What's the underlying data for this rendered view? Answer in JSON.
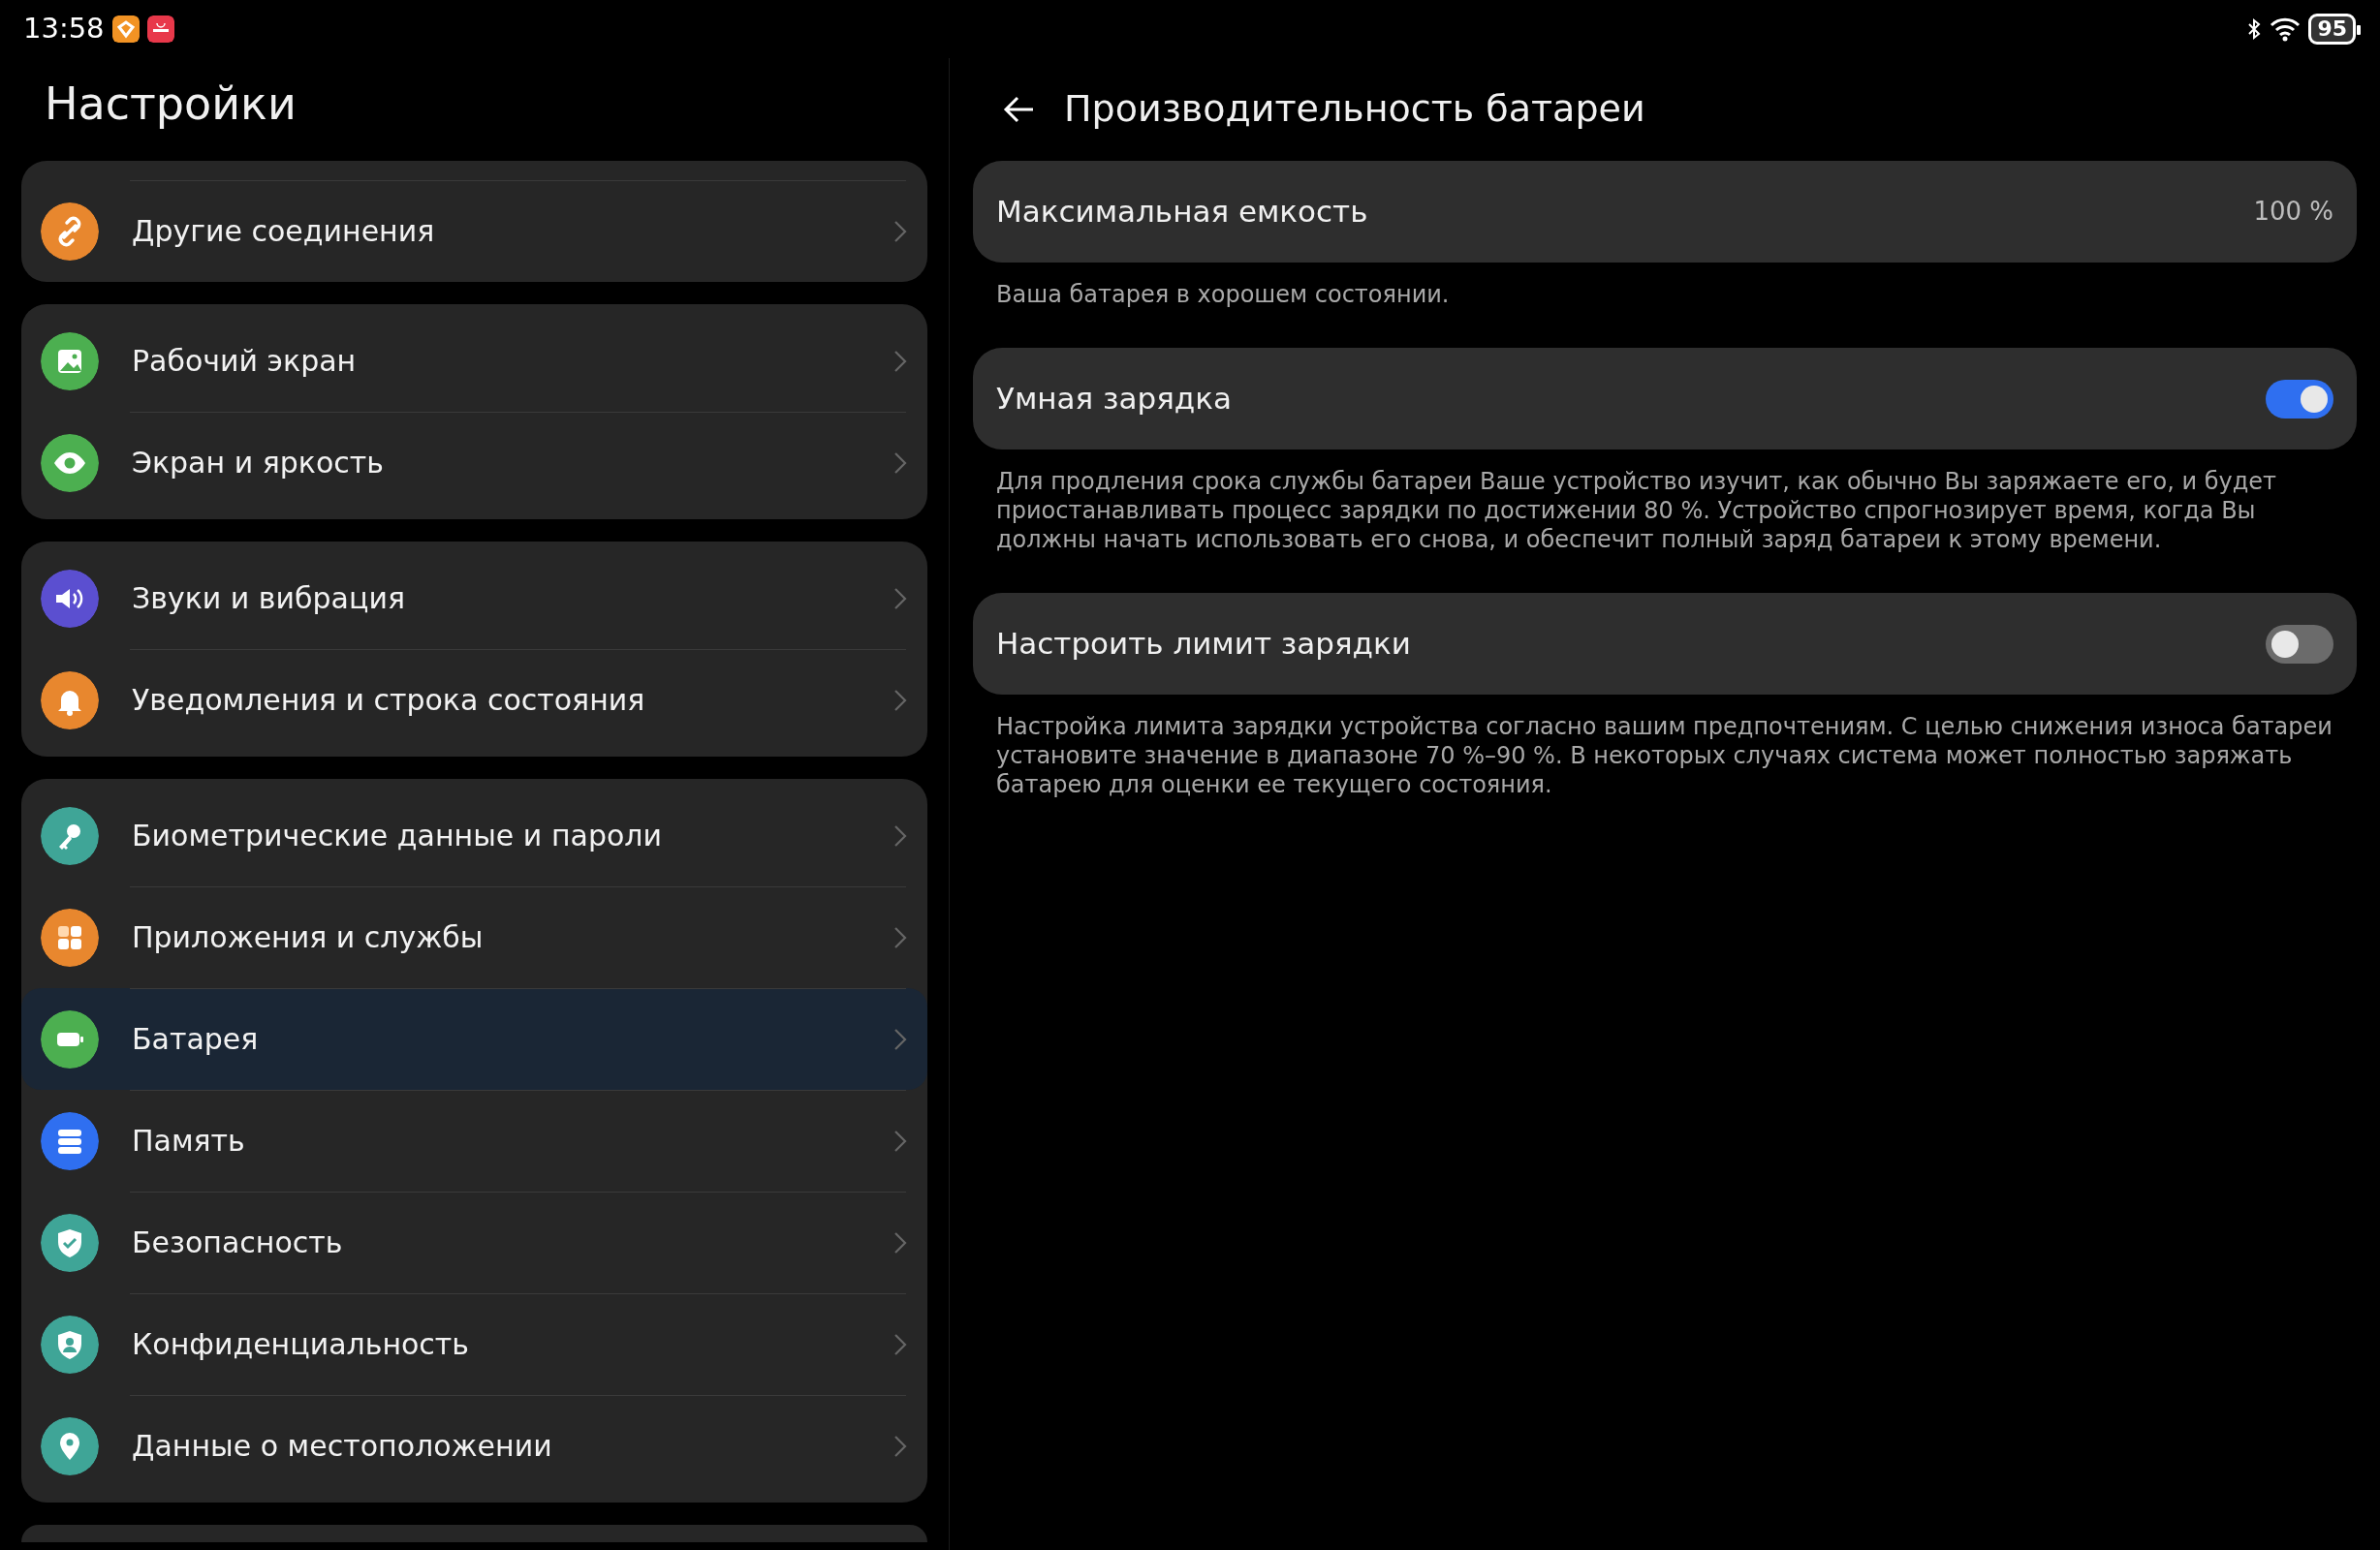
{
  "status_bar": {
    "time": "13:58",
    "battery": "95"
  },
  "sidebar": {
    "title": "Настройки",
    "groups": [
      {
        "partial_top": true,
        "items": [
          {
            "label": "Другие соединения",
            "kind": "link",
            "color": "#e8872e",
            "selected": false
          }
        ]
      },
      {
        "partial_top": false,
        "items": [
          {
            "label": "Рабочий экран",
            "kind": "image",
            "color": "#4caf50",
            "selected": false
          },
          {
            "label": "Экран и яркость",
            "kind": "eye",
            "color": "#4caf50",
            "selected": false
          }
        ]
      },
      {
        "partial_top": false,
        "items": [
          {
            "label": "Звуки и вибрация",
            "kind": "sound",
            "color": "#5b4fd0",
            "selected": false
          },
          {
            "label": "Уведомления и строка состояния",
            "kind": "bell",
            "color": "#e8872e",
            "selected": false
          }
        ]
      },
      {
        "partial_top": false,
        "items": [
          {
            "label": "Биометрические данные и пароли",
            "kind": "key",
            "color": "#3fa597",
            "selected": false
          },
          {
            "label": "Приложения и службы",
            "kind": "apps",
            "color": "#e8872e",
            "selected": false
          },
          {
            "label": "Батарея",
            "kind": "battery",
            "color": "#4caf50",
            "selected": true
          },
          {
            "label": "Память",
            "kind": "storage",
            "color": "#2f6ff0",
            "selected": false
          },
          {
            "label": "Безопасность",
            "kind": "shield-check",
            "color": "#3fa597",
            "selected": false
          },
          {
            "label": "Конфиденциальность",
            "kind": "shield-person",
            "color": "#3fa597",
            "selected": false
          },
          {
            "label": "Данные о местоположении",
            "kind": "pin",
            "color": "#3fa597",
            "selected": false
          }
        ]
      }
    ]
  },
  "detail": {
    "title": "Производительность батареи",
    "settings": [
      {
        "kind": "value",
        "label": "Максимальная емкость",
        "value": "100 %",
        "description": "Ваша батарея в хорошем состоянии."
      },
      {
        "kind": "toggle",
        "label": "Умная зарядка",
        "on": true,
        "description": "Для продления срока службы батареи Ваше устройство изучит, как обычно Вы заряжаете его, и будет приостанавливать процесс зарядки по достижении 80 %. Устройство спрогнозирует время, когда Вы должны начать использовать его снова, и обеспечит полный заряд батареи к этому времени."
      },
      {
        "kind": "toggle",
        "label": "Настроить лимит зарядки",
        "on": false,
        "description": "Настройка лимита зарядки устройства согласно вашим предпочтениям. С целью снижения износа батареи установите значение в диапазоне 70 %–90 %. В некоторых случаях система может полностью заряжать батарею для оценки ее текущего состояния."
      }
    ]
  }
}
